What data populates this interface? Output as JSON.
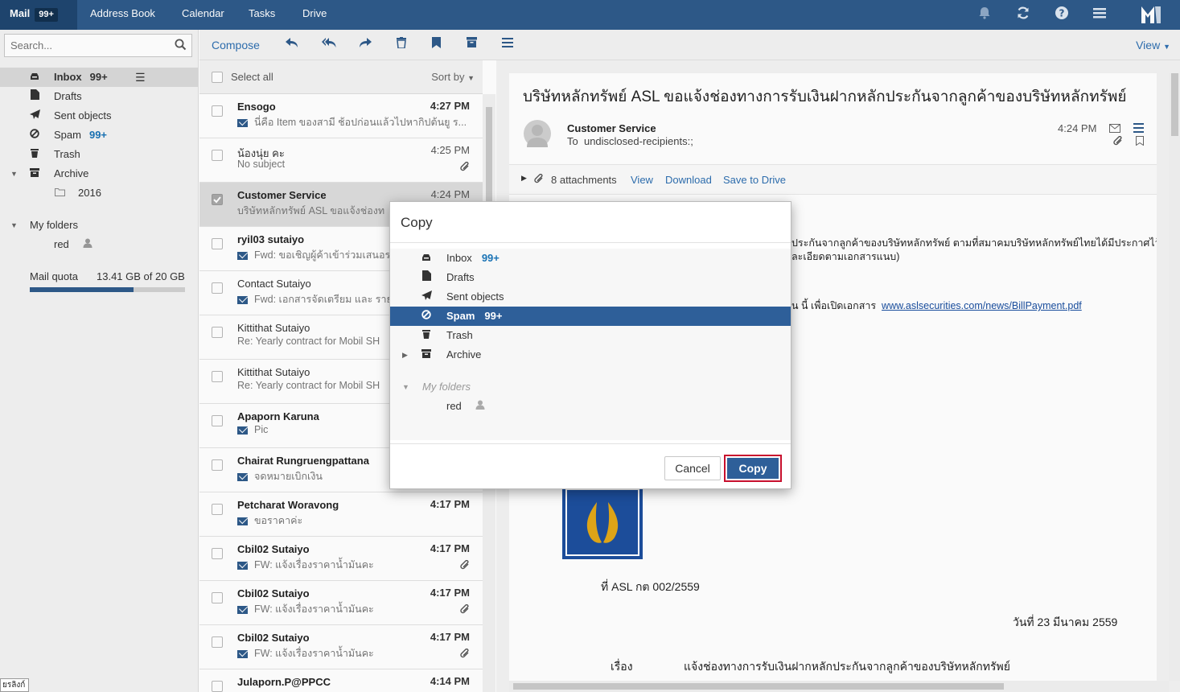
{
  "topnav": {
    "mail": "Mail",
    "mail_count": "99+",
    "tabs": [
      "Address Book",
      "Calendar",
      "Tasks",
      "Drive"
    ]
  },
  "search": {
    "placeholder": "Search..."
  },
  "folders": [
    {
      "name": "Inbox",
      "count": "99+",
      "icon": "inbox-icon"
    },
    {
      "name": "Drafts",
      "count": "",
      "icon": "draft-icon"
    },
    {
      "name": "Sent objects",
      "count": "",
      "icon": "send-icon"
    },
    {
      "name": "Spam",
      "count": "99+",
      "icon": "spam-icon"
    },
    {
      "name": "Trash",
      "count": "",
      "icon": "trash-icon"
    },
    {
      "name": "Archive",
      "count": "",
      "icon": "archive-icon"
    },
    {
      "name": "2016",
      "count": "",
      "icon": "folder-icon"
    }
  ],
  "my_folders": {
    "title": "My folders",
    "items": [
      "red"
    ]
  },
  "quota": {
    "label": "Mail quota",
    "value": "13.41 GB of 20 GB",
    "used_fraction": 0.67
  },
  "toolbar": {
    "compose": "Compose",
    "view": "View"
  },
  "list": {
    "select_all": "Select all",
    "sort_by": "Sort by",
    "rows": [
      {
        "from": "Ensogo",
        "time": "4:27 PM",
        "subject": "นี่คือ Item ของสามี ช้อปก่อนแล้วไปหากิปต้นยู ร...",
        "unread": true,
        "envelope": true,
        "clip": false
      },
      {
        "from": "น้องนุ่ย คะ",
        "time": "4:25 PM",
        "subject": "No subject",
        "unread": false,
        "envelope": false,
        "clip": true
      },
      {
        "from": "Customer Service",
        "time": "4:24 PM",
        "subject": "บริษัทหลักทรัพย์ ASL ขอแจ้งช่องท",
        "unread": false,
        "envelope": false,
        "clip": false,
        "selected": true
      },
      {
        "from": "ryil03 sutaiyo",
        "time": "",
        "subject": "Fwd: ขอเชิญผู้ค้าเข้าร่วมเสนอร",
        "unread": true,
        "envelope": true,
        "clip": false
      },
      {
        "from": "Contact Sutaiyo",
        "time": "",
        "subject": "Fwd: เอกสารจัดเตรียม และ ราย",
        "unread": false,
        "envelope": true,
        "clip": false
      },
      {
        "from": "Kittithat Sutaiyo",
        "time": "",
        "subject": "Re: Yearly contract for Mobil SH",
        "unread": false,
        "envelope": false,
        "clip": false
      },
      {
        "from": "Kittithat Sutaiyo",
        "time": "",
        "subject": "Re: Yearly contract for Mobil SH",
        "unread": false,
        "envelope": false,
        "clip": false
      },
      {
        "from": "Apaporn Karuna",
        "time": "",
        "subject": "Pic",
        "unread": true,
        "envelope": true,
        "clip": false
      },
      {
        "from": "Chairat Rungruengpattana",
        "time": "",
        "subject": "จดหมายเบิกเงิน",
        "unread": true,
        "envelope": true,
        "clip": false
      },
      {
        "from": "Petcharat Woravong",
        "time": "4:17 PM",
        "subject": "ขอราคาค่ะ",
        "unread": true,
        "envelope": true,
        "clip": false
      },
      {
        "from": "Cbil02 Sutaiyo",
        "time": "4:17 PM",
        "subject": "FW: แจ้งเรื่องราคาน้ำมันคะ",
        "unread": true,
        "envelope": true,
        "clip": true
      },
      {
        "from": "Cbil02 Sutaiyo",
        "time": "4:17 PM",
        "subject": "FW: แจ้งเรื่องราคาน้ำมันคะ",
        "unread": true,
        "envelope": true,
        "clip": true
      },
      {
        "from": "Cbil02 Sutaiyo",
        "time": "4:17 PM",
        "subject": "FW: แจ้งเรื่องราคาน้ำมันคะ",
        "unread": true,
        "envelope": true,
        "clip": true
      },
      {
        "from": "Julaporn.P@PPCC",
        "time": "4:14 PM",
        "subject": "",
        "unread": true,
        "envelope": false,
        "clip": false
      }
    ]
  },
  "mail": {
    "subject": "บริษัทหลักทรัพย์ ASL ขอแจ้งช่องทางการรับเงินฝากหลักประกันจากลูกค้าของบริษัทหลักทรัพย์",
    "sender": "Customer Service",
    "to_label": "To",
    "recipients": "undisclosed-recipients:;",
    "time": "4:24 PM",
    "attachments": "8 attachments",
    "att_view": "View",
    "att_download": "Download",
    "att_drive": "Save to Drive",
    "body_line1": "ประกันจากลูกค้าของบริษัทหลักทรัพย์ ตามที่สมาคมบริษัทหลักทรัพย์ไทยได้มีประกาศไว้",
    "body_line2": "ละเอียดตามเอกสารแนบ)",
    "body_line3": "น นี้ เพื่อเปิดเอกสาร",
    "body_url": "www.aslsecurities.com/news/BillPayment.pdf",
    "ref_no": "ที่  ASL กต 002/2559",
    "date_line": "วันที่  23  มีนาคม  2559",
    "subj_label": "เรื่อง",
    "subj_text": "แจ้งช่องทางการรับเงินฝากหลักประกันจากลูกค้าของบริษัทหลักทรัพย์"
  },
  "dialog": {
    "title": "Copy",
    "folders": [
      {
        "name": "Inbox",
        "count": "99+"
      },
      {
        "name": "Drafts",
        "count": ""
      },
      {
        "name": "Sent objects",
        "count": ""
      },
      {
        "name": "Spam",
        "count": "99+"
      },
      {
        "name": "Trash",
        "count": ""
      },
      {
        "name": "Archive",
        "count": ""
      }
    ],
    "my_folders": "My folders",
    "my_folder_items": [
      "red"
    ],
    "cancel": "Cancel",
    "copy": "Copy"
  },
  "tooltip": "ยรลิงก์"
}
